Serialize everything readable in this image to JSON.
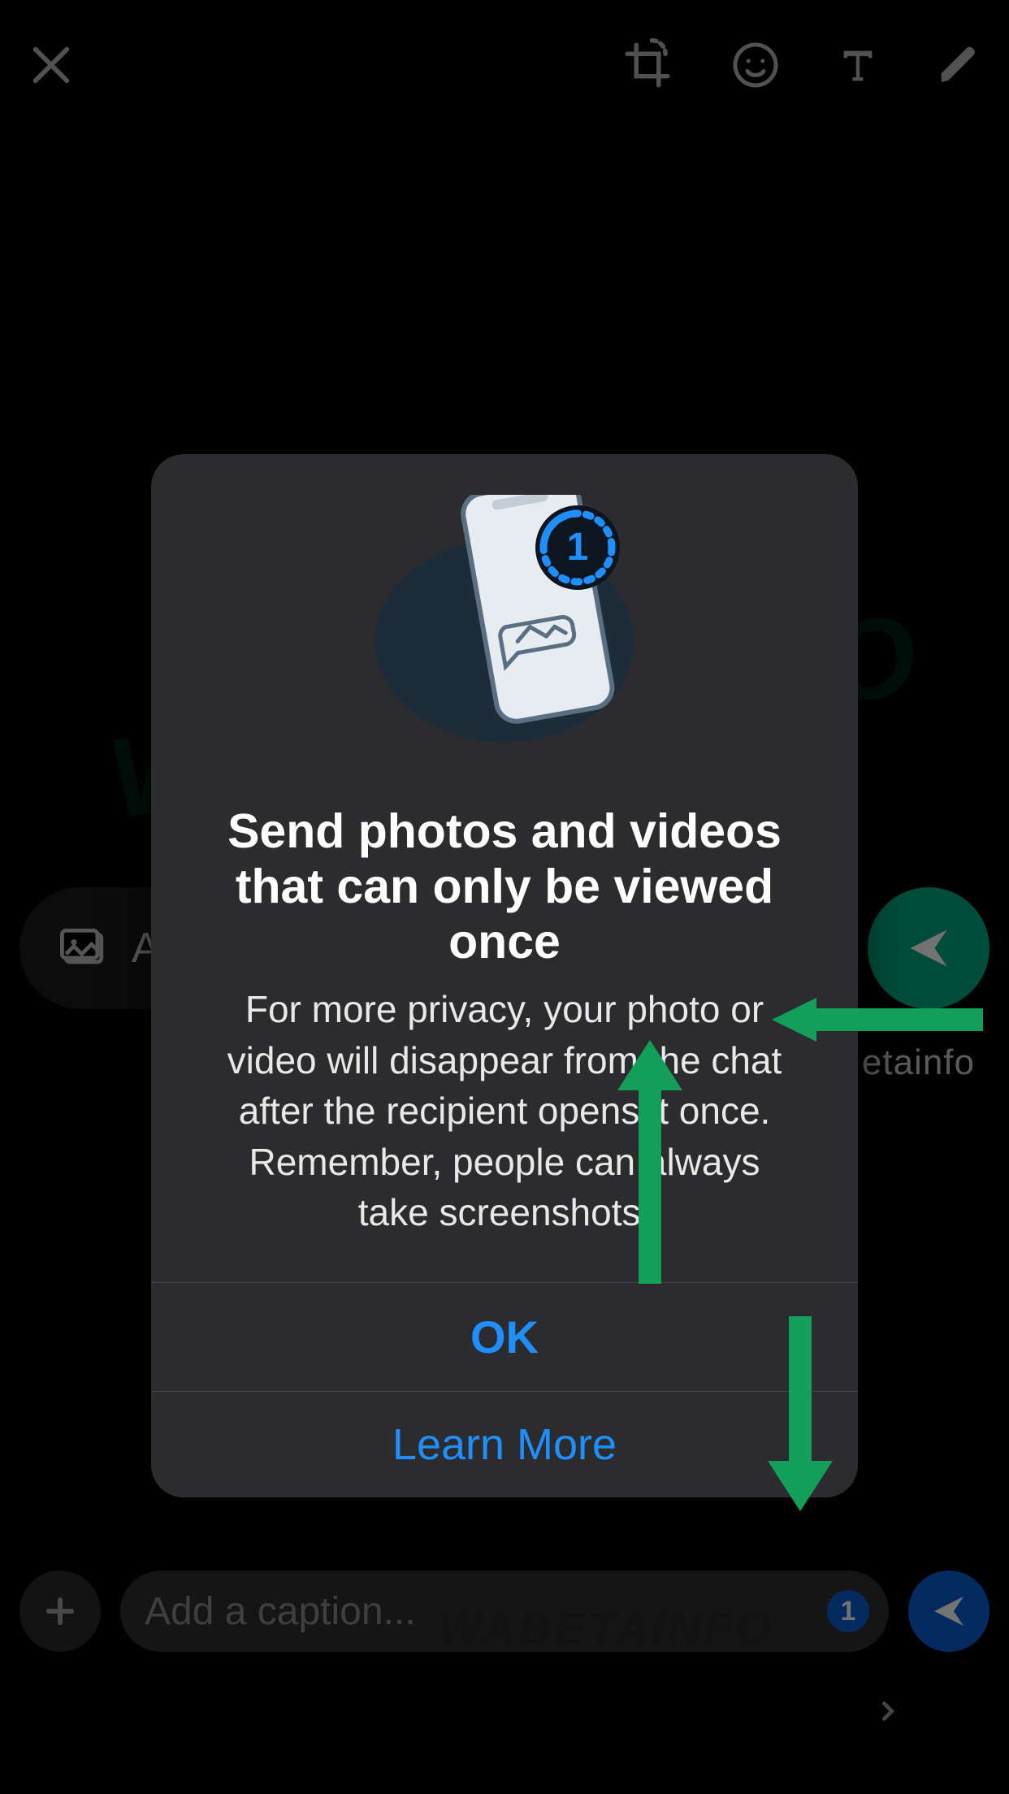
{
  "modal": {
    "title": "Send photos and videos that can only be viewed once",
    "body": "For more privacy, your photo or video will disappear from the chat after the recipient opens it once. Remember, people can always take screenshots.",
    "ok_label": "OK",
    "learn_more_label": "Learn More"
  },
  "caption": {
    "placeholder": "Add a caption...",
    "view_once_badge": "1"
  },
  "preview": {
    "hint_char": "A"
  },
  "watermark": {
    "main": "WABETAINFO",
    "small": "etainfo",
    "caption_overlay": "WABETAINFO"
  }
}
